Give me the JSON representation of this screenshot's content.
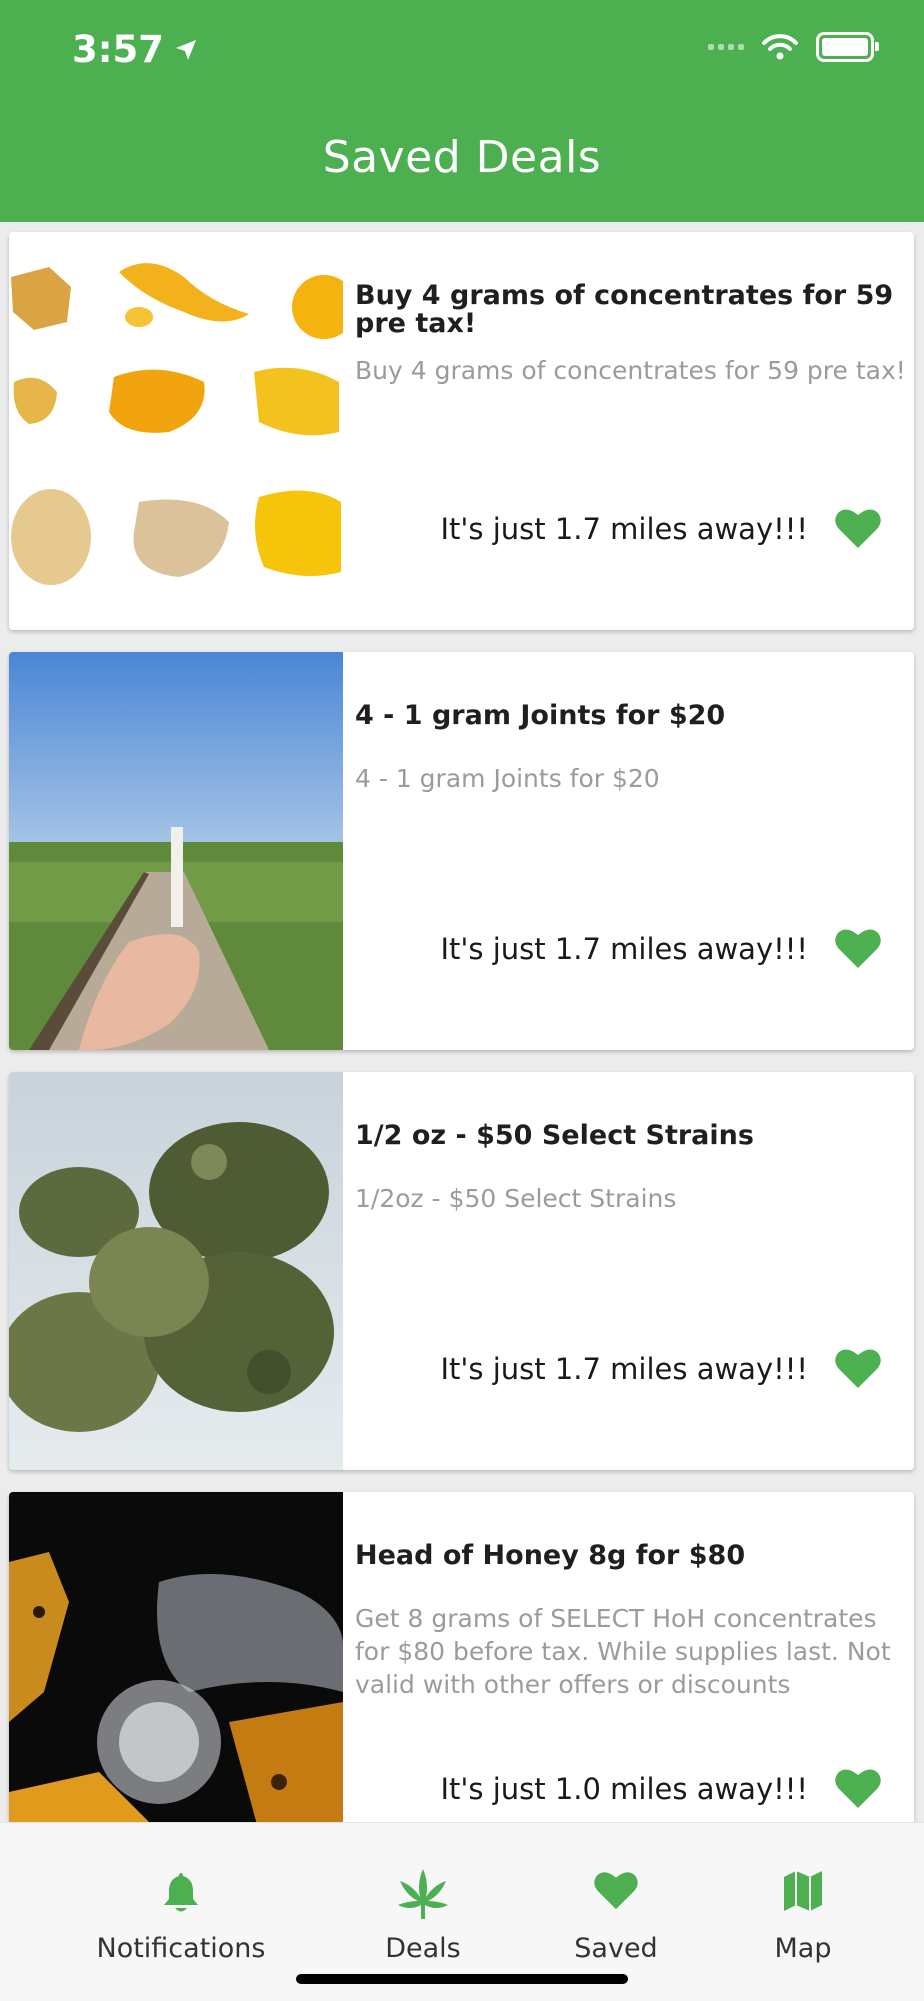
{
  "status": {
    "time": "3:57"
  },
  "header": {
    "title": "Saved Deals"
  },
  "colors": {
    "brand": "#4caf50",
    "heart": "#4caf50"
  },
  "deals": [
    {
      "title": "Buy 4 grams of concentrates for 59 pre tax!",
      "description": "Buy 4 grams of concentrates for 59 pre tax!",
      "distance": "It's just 1.7 miles away!!!",
      "image": "concentrates-photo",
      "favorited": true
    },
    {
      "title": "4 - 1 gram Joints for $20",
      "description": "4 - 1 gram Joints for $20",
      "distance": "It's just 1.7 miles away!!!",
      "image": "joint-boardwalk-photo",
      "favorited": true
    },
    {
      "title": "1/2 oz - $50 Select Strains",
      "description": "1/2oz - $50 Select Strains",
      "distance": "It's just 1.7 miles away!!!",
      "image": "cannabis-buds-photo",
      "favorited": true
    },
    {
      "title": "Head of Honey 8g for $80",
      "description": "Get 8 grams of SELECT HoH concentrates for $80 before tax. While supplies last. Not valid with other offers or discounts",
      "distance": "It's just 1.0 miles away!!!",
      "image": "glass-shatter-photo",
      "favorited": true
    }
  ],
  "tabs": [
    {
      "label": "Notifications",
      "icon": "bell-icon"
    },
    {
      "label": "Deals",
      "icon": "cannabis-leaf-icon"
    },
    {
      "label": "Saved",
      "icon": "heart-icon"
    },
    {
      "label": "Map",
      "icon": "map-icon"
    }
  ]
}
